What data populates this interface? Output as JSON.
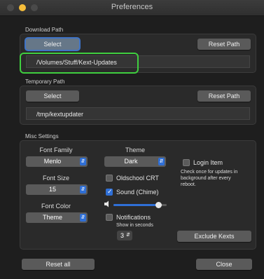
{
  "window": {
    "title": "Preferences"
  },
  "download": {
    "group_title": "Download Path",
    "select_label": "Select",
    "reset_label": "Reset Path",
    "path_value": "/Volumes/Stuff/Kext-Updates"
  },
  "temporary": {
    "group_title": "Temporary Path",
    "select_label": "Select",
    "reset_label": "Reset Path",
    "path_value": "/tmp/kextupdater"
  },
  "misc": {
    "group_title": "Misc Settings",
    "font_family": {
      "label": "Font Family",
      "value": "Menlo"
    },
    "font_size": {
      "label": "Font Size",
      "value": "15"
    },
    "font_color": {
      "label": "Font Color",
      "value": "Theme"
    },
    "theme": {
      "label": "Theme",
      "value": "Dark"
    },
    "oldschool_crt": {
      "label": "Oldschool CRT",
      "checked": false
    },
    "sound": {
      "label": "Sound (Chime)",
      "checked": true,
      "volume_fraction": 0.85
    },
    "notifications": {
      "label": "Notifications",
      "checked": false,
      "seconds_label": "Show in seconds",
      "seconds_value": "3"
    },
    "login_item": {
      "label": "Login Item",
      "checked": false,
      "help": "Check once for updates in background after every reboot."
    },
    "exclude_label": "Exclude Kexts"
  },
  "footer": {
    "reset_all_label": "Reset all",
    "close_label": "Close"
  },
  "colors": {
    "accent": "#2f6fd6",
    "highlight": "#3fcf3f",
    "background": "#1e1e1e"
  },
  "icons": [
    "speaker-icon",
    "popup-arrow-icon",
    "checkmark-icon",
    "stepper-icon"
  ]
}
